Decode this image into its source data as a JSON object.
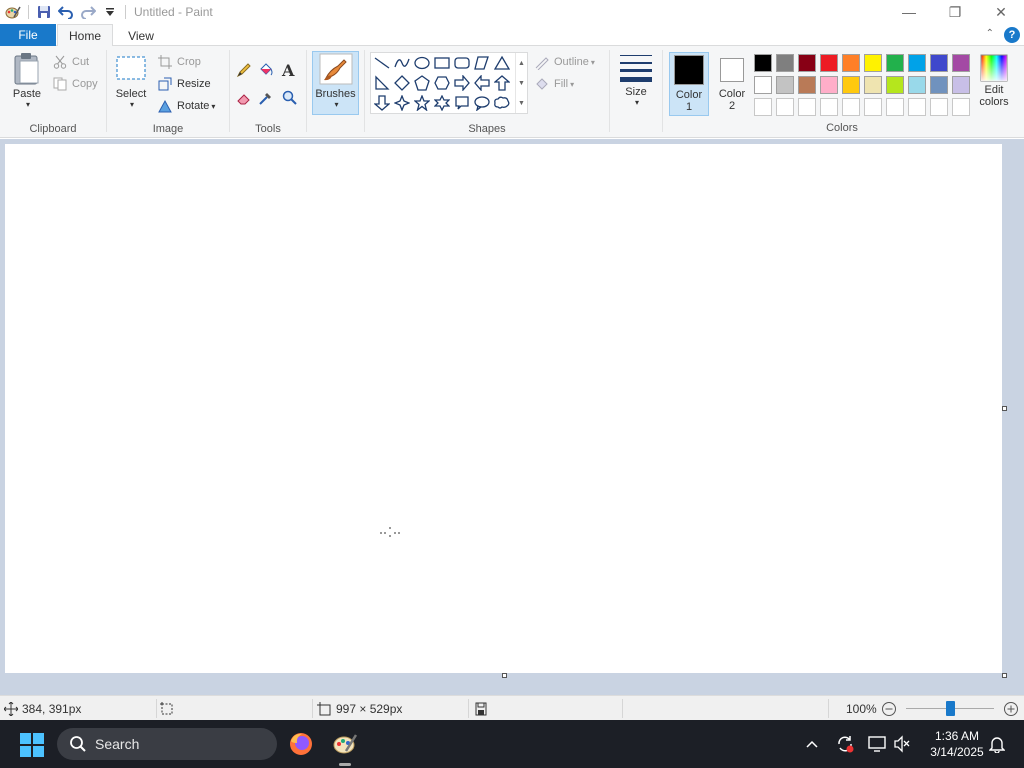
{
  "window": {
    "title": "Untitled - Paint",
    "minimize": "—",
    "restore": "❐",
    "close": "✕"
  },
  "tabs": {
    "file": "File",
    "home": "Home",
    "view": "View",
    "collapse": "⌃",
    "help": "?"
  },
  "clipboard": {
    "label": "Clipboard",
    "paste": "Paste",
    "cut": "Cut",
    "copy": "Copy"
  },
  "image": {
    "label": "Image",
    "select": "Select",
    "crop": "Crop",
    "resize": "Resize",
    "rotate": "Rotate"
  },
  "tools": {
    "label": "Tools",
    "text_glyph": "A"
  },
  "brushes": {
    "label": "Brushes"
  },
  "shapes": {
    "label": "Shapes",
    "outline": "Outline",
    "fill": "Fill"
  },
  "size": {
    "label": "Size"
  },
  "colors": {
    "label": "Colors",
    "color1_line1": "Color",
    "color1_line2": "1",
    "color2_line1": "Color",
    "color2_line2": "2",
    "edit_line1": "Edit",
    "edit_line2": "colors",
    "color1_value": "#000000",
    "color2_value": "#ffffff",
    "palette_row1": [
      "#000000",
      "#7f7f7f",
      "#880015",
      "#ed1c24",
      "#ff7f27",
      "#fff200",
      "#22b14c",
      "#00a2e8",
      "#3f48cc",
      "#a349a4"
    ],
    "palette_row2": [
      "#ffffff",
      "#c3c3c3",
      "#b97a57",
      "#ffaec9",
      "#ffc90e",
      "#efe4b0",
      "#b5e61d",
      "#99d9ea",
      "#7092be",
      "#c8bfe7"
    ],
    "palette_row3": [
      "#ffffff",
      "#ffffff",
      "#ffffff",
      "#ffffff",
      "#ffffff",
      "#ffffff",
      "#ffffff",
      "#ffffff",
      "#ffffff",
      "#ffffff"
    ]
  },
  "status": {
    "cursor_pos": "384, 391px",
    "canvas_size": "997 × 529px",
    "zoom": "100%",
    "zoom_level": 1.0
  },
  "taskbar": {
    "search": "Search",
    "time": "1:36 AM",
    "date": "3/14/2025"
  }
}
